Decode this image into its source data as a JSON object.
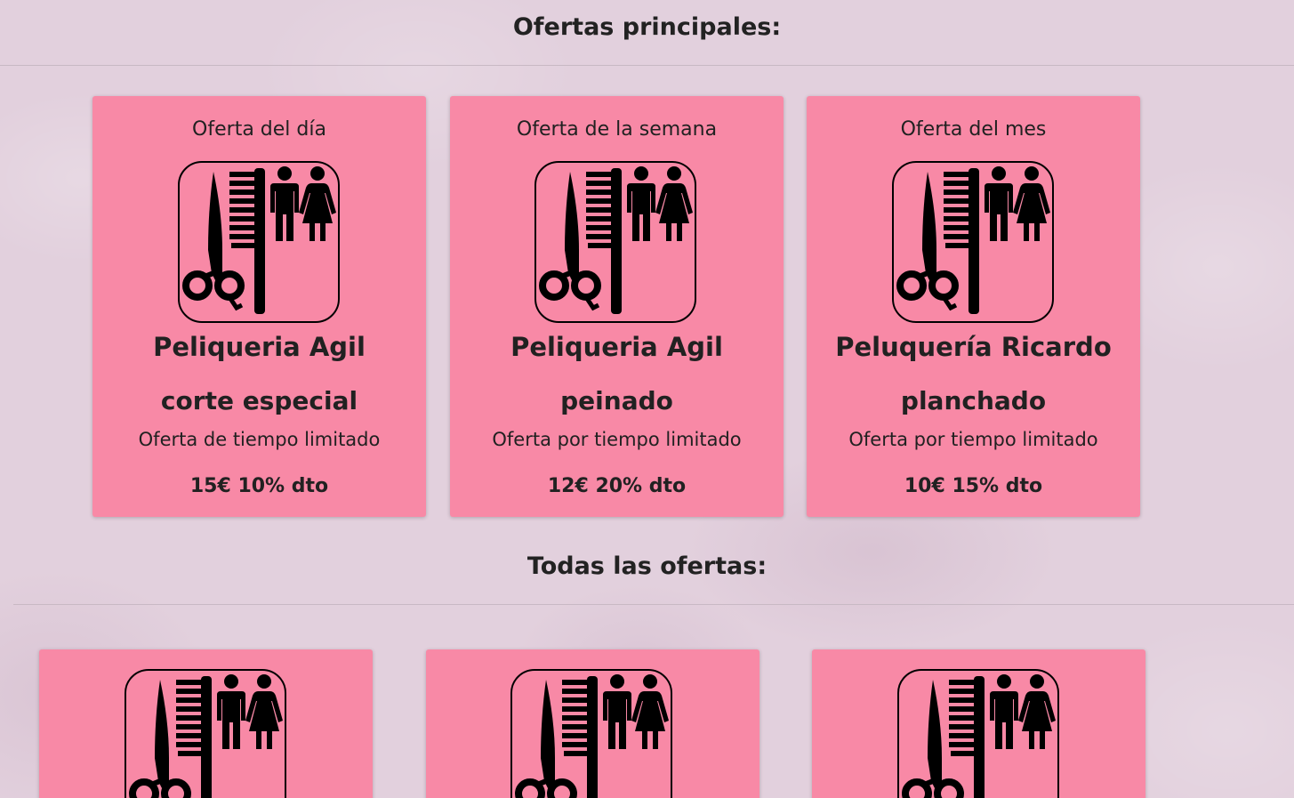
{
  "main_section": {
    "title": "Ofertas principales:",
    "offers": [
      {
        "heading": "Oferta del día",
        "salon": "Peliqueria Agil",
        "service": "corte especial",
        "subtitle": "Oferta de tiempo limitado",
        "price": "15€ 10% dto",
        "icon": "hair-salon-icon"
      },
      {
        "heading": "Oferta de la semana",
        "salon": "Peliqueria Agil",
        "service": "peinado",
        "subtitle": "Oferta por tiempo limitado",
        "price": "12€ 20% dto",
        "icon": "hair-salon-icon"
      },
      {
        "heading": "Oferta del mes",
        "salon": "Peluquería Ricardo",
        "service": "planchado",
        "subtitle": "Oferta por tiempo limitado",
        "price": "10€ 15% dto",
        "icon": "hair-salon-icon"
      }
    ]
  },
  "all_section": {
    "title": "Todas las ofertas:",
    "offers": [
      {
        "icon": "hair-salon-icon"
      },
      {
        "icon": "hair-salon-icon"
      },
      {
        "icon": "hair-salon-icon"
      }
    ]
  },
  "colors": {
    "card_background": "#f889a6",
    "page_background": "#e2d0dd",
    "text": "#212121"
  }
}
